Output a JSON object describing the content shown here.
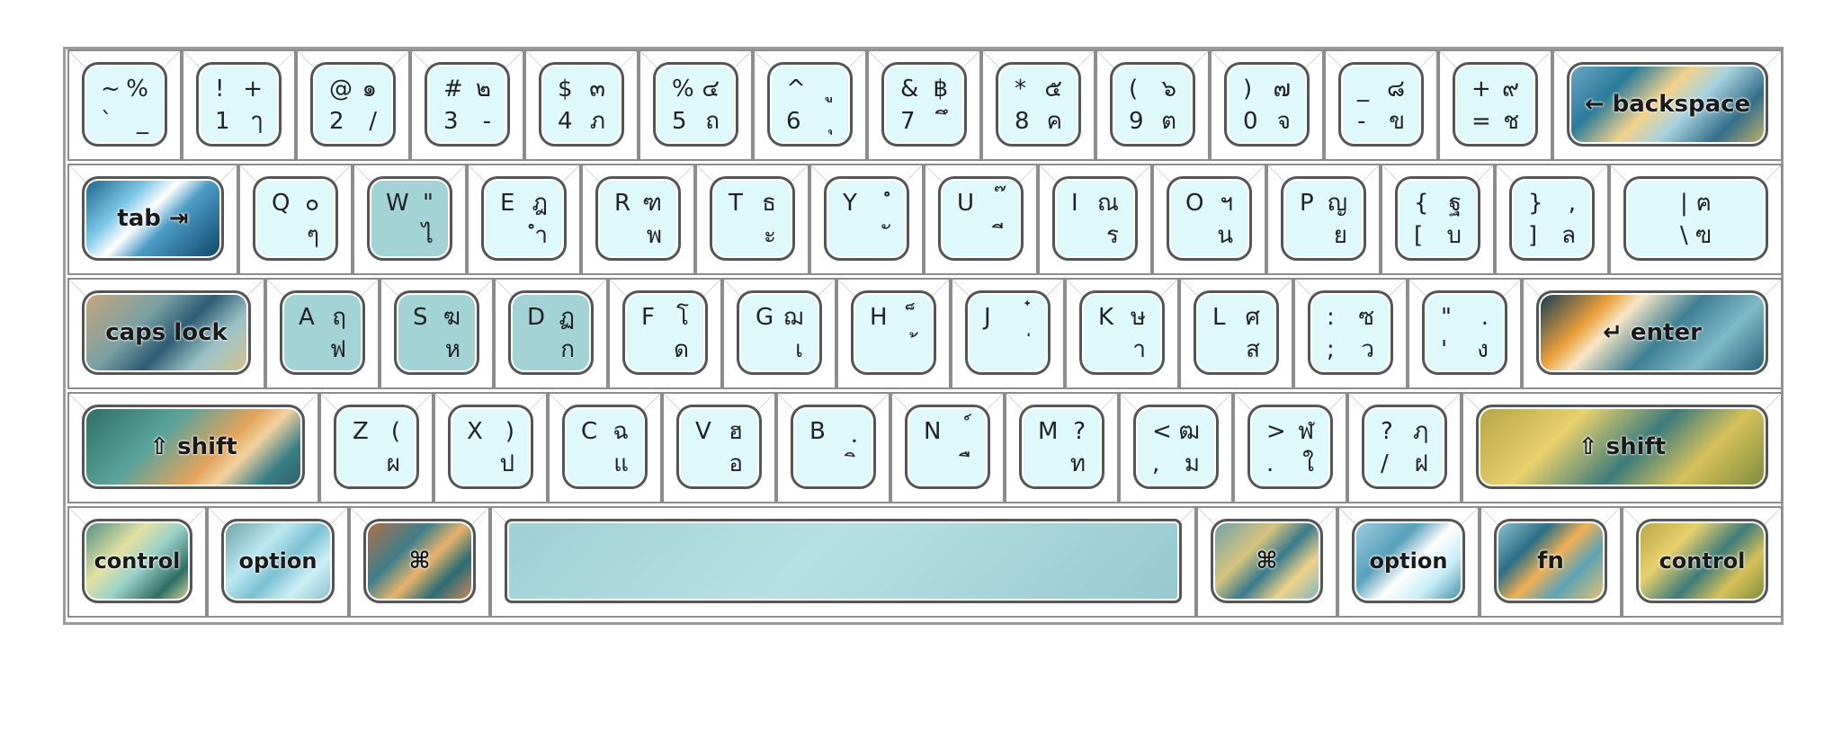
{
  "keyboard": {
    "row1": [
      {
        "tl": "~",
        "tr": "%",
        "bl": "`",
        "br": "_"
      },
      {
        "tl": "!",
        "tr": "+",
        "bl": "1",
        "br": "ๅ"
      },
      {
        "tl": "@",
        "tr": "๑",
        "bl": "2",
        "br": "/"
      },
      {
        "tl": "#",
        "tr": "๒",
        "bl": "3",
        "br": "-"
      },
      {
        "tl": "$",
        "tr": "๓",
        "bl": "4",
        "br": "ภ"
      },
      {
        "tl": "%",
        "tr": "๔",
        "bl": "5",
        "br": "ถ"
      },
      {
        "tl": "^",
        "tr": "ู",
        "bl": "6",
        "br": "ุ"
      },
      {
        "tl": "&",
        "tr": "฿",
        "bl": "7",
        "br": "ึ"
      },
      {
        "tl": "*",
        "tr": "๕",
        "bl": "8",
        "br": "ค"
      },
      {
        "tl": "(",
        "tr": "๖",
        "bl": "9",
        "br": "ต"
      },
      {
        "tl": ")",
        "tr": "๗",
        "bl": "0",
        "br": "จ"
      },
      {
        "tl": "_",
        "tr": "๘",
        "bl": "-",
        "br": "ข"
      },
      {
        "tl": "+",
        "tr": "๙",
        "bl": "=",
        "br": "ช"
      },
      {
        "label": "← backspace"
      }
    ],
    "row2": [
      {
        "label": "tab ⇥"
      },
      {
        "tl": "Q",
        "tr": "๐",
        "bl": "",
        "br": "ๆ"
      },
      {
        "tl": "W",
        "tr": "\"",
        "bl": "",
        "br": "ไ"
      },
      {
        "tl": "E",
        "tr": "ฎ",
        "bl": "",
        "br": "ำ"
      },
      {
        "tl": "R",
        "tr": "ฑ",
        "bl": "",
        "br": "พ"
      },
      {
        "tl": "T",
        "tr": "ธ",
        "bl": "",
        "br": "ะ"
      },
      {
        "tl": "Y",
        "tr": "ํ",
        "bl": "",
        "br": "ั"
      },
      {
        "tl": "U",
        "tr": "๊",
        "bl": "",
        "br": "ี"
      },
      {
        "tl": "I",
        "tr": "ณ",
        "bl": "",
        "br": "ร"
      },
      {
        "tl": "O",
        "tr": "ฯ",
        "bl": "",
        "br": "น"
      },
      {
        "tl": "P",
        "tr": "ญ",
        "bl": "",
        "br": "ย"
      },
      {
        "tl": "{",
        "tr": "ฐ",
        "bl": "[",
        "br": "บ"
      },
      {
        "tl": "}",
        "tr": ",",
        "bl": "]",
        "br": "ล"
      },
      {
        "tl": "|",
        "tr": "ฅ",
        "bl": "\\",
        "br": "ฃ"
      }
    ],
    "row3": [
      {
        "label": "caps lock"
      },
      {
        "tl": "A",
        "tr": "ฤ",
        "bl": "",
        "br": "ฟ"
      },
      {
        "tl": "S",
        "tr": "ฆ",
        "bl": "",
        "br": "ห"
      },
      {
        "tl": "D",
        "tr": "ฏ",
        "bl": "",
        "br": "ก"
      },
      {
        "tl": "F",
        "tr": "โ",
        "bl": "",
        "br": "ด"
      },
      {
        "tl": "G",
        "tr": "ฌ",
        "bl": "",
        "br": "เ"
      },
      {
        "tl": "H",
        "tr": "็",
        "bl": "",
        "br": "้"
      },
      {
        "tl": "J",
        "tr": "๋",
        "bl": "",
        "br": "่"
      },
      {
        "tl": "K",
        "tr": "ษ",
        "bl": "",
        "br": "า"
      },
      {
        "tl": "L",
        "tr": "ศ",
        "bl": "",
        "br": "ส"
      },
      {
        "tl": ":",
        "tr": "ซ",
        "bl": ";",
        "br": "ว"
      },
      {
        "tl": "\"",
        "tr": ".",
        "bl": "'",
        "br": "ง"
      },
      {
        "label": "↵ enter"
      }
    ],
    "row4": [
      {
        "label": "⇧ shift"
      },
      {
        "tl": "Z",
        "tr": "(",
        "bl": "",
        "br": "ผ"
      },
      {
        "tl": "X",
        "tr": ")",
        "bl": "",
        "br": "ป"
      },
      {
        "tl": "C",
        "tr": "ฉ",
        "bl": "",
        "br": "แ"
      },
      {
        "tl": "V",
        "tr": "ฮ",
        "bl": "",
        "br": "อ"
      },
      {
        "tl": "B",
        "tr": "ฺ",
        "bl": "",
        "br": "ิ"
      },
      {
        "tl": "N",
        "tr": "์",
        "bl": "",
        "br": "ื"
      },
      {
        "tl": "M",
        "tr": "?",
        "bl": "",
        "br": "ท"
      },
      {
        "tl": "<",
        "tr": "ฒ",
        "bl": ",",
        "br": "ม"
      },
      {
        "tl": ">",
        "tr": "ฬ",
        "bl": ".",
        "br": "ใ"
      },
      {
        "tl": "?",
        "tr": "ฦ",
        "bl": "/",
        "br": "ฝ"
      },
      {
        "label": "⇧ shift"
      }
    ],
    "row5": [
      {
        "label": "control"
      },
      {
        "label": "option"
      },
      {
        "label": "⌘"
      },
      {
        "label": ""
      },
      {
        "label": "⌘"
      },
      {
        "label": "option"
      },
      {
        "label": "fn"
      },
      {
        "label": "control"
      }
    ]
  },
  "colors": {
    "key_face": "#dff9fb",
    "key_face_highlight": "#a4d3d6",
    "key_border": "#555555"
  }
}
